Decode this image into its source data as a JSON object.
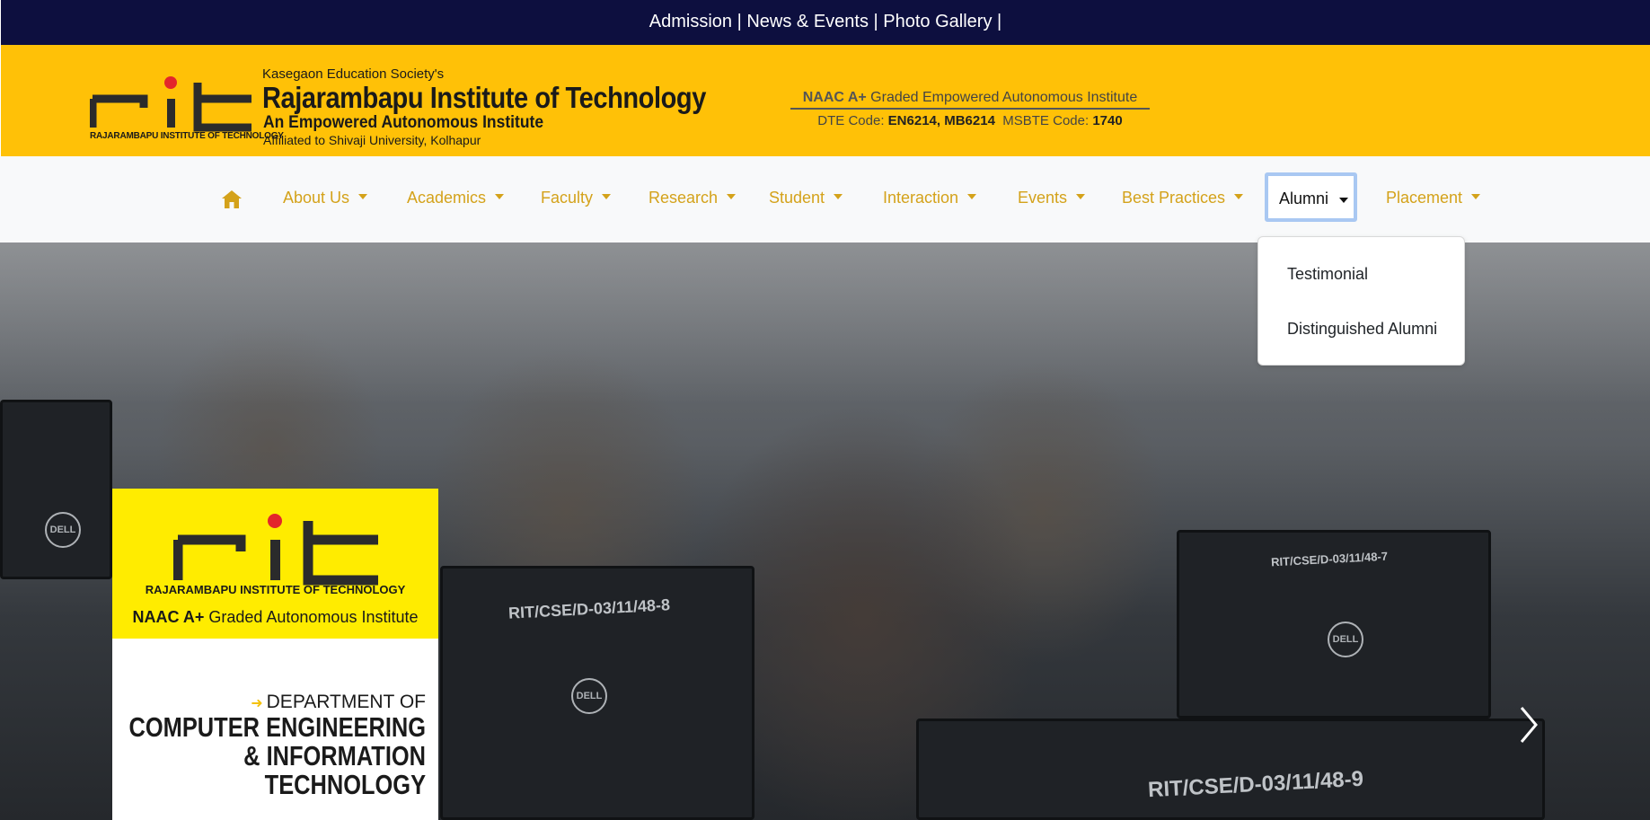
{
  "topbar": {
    "links": [
      "Admission",
      "News & Events",
      "Photo Gallery"
    ],
    "separator": " | "
  },
  "header": {
    "logo_caption": "RAJARAMBAPU INSTITUTE OF TECHNOLOGY",
    "society": "Kasegaon Education Society's",
    "institute_name": "Rajarambapu Institute of Technology",
    "tagline": "An Empowered Autonomous Institute",
    "affiliation": "Affiliated to Shivaji University, Kolhapur",
    "accreditation": {
      "naac_grade": "NAAC A+",
      "naac_text": "Graded Empowered Autonomous Institute",
      "dte_label": "DTE Code:",
      "dte_codes": "EN6214, MB6214",
      "msbte_label": "MSBTE Code:",
      "msbte_code": "1740"
    }
  },
  "nav": {
    "items": [
      {
        "label": "About Us"
      },
      {
        "label": "Academics"
      },
      {
        "label": "Faculty"
      },
      {
        "label": "Research"
      },
      {
        "label": "Student"
      },
      {
        "label": "Interaction"
      },
      {
        "label": "Events"
      },
      {
        "label": "Best Practices"
      },
      {
        "label": "Alumni"
      },
      {
        "label": "Placement"
      }
    ],
    "home_icon": "home-icon",
    "accent_color": "#d4a21a"
  },
  "dropdown": {
    "items": [
      "Testimonial",
      "Distinguished Alumni"
    ]
  },
  "hero": {
    "card": {
      "logo_caption": "RAJARAMBAPU INSTITUTE OF TECHNOLOGY",
      "naac_grade": "NAAC A+",
      "naac_text": "Graded Autonomous Institute",
      "dept_of": "DEPARTMENT OF",
      "dept_line1": "COMPUTER ENGINEERING",
      "dept_line2": "& INFORMATION",
      "dept_line3": "TECHNOLOGY"
    },
    "monitor_labels": [
      "RIT/CSE/D-03/11/48-8",
      "RIT/CSE/D-03/11/48-9",
      "RIT/CSE/D-03/11/48-7"
    ],
    "monitor_brand": "DELL",
    "next_icon": "chevron-right-icon"
  },
  "colors": {
    "topbar": "#0d0f3f",
    "header": "#ffc107",
    "card_yellow": "#ffec00",
    "logo_red": "#e3262b"
  }
}
